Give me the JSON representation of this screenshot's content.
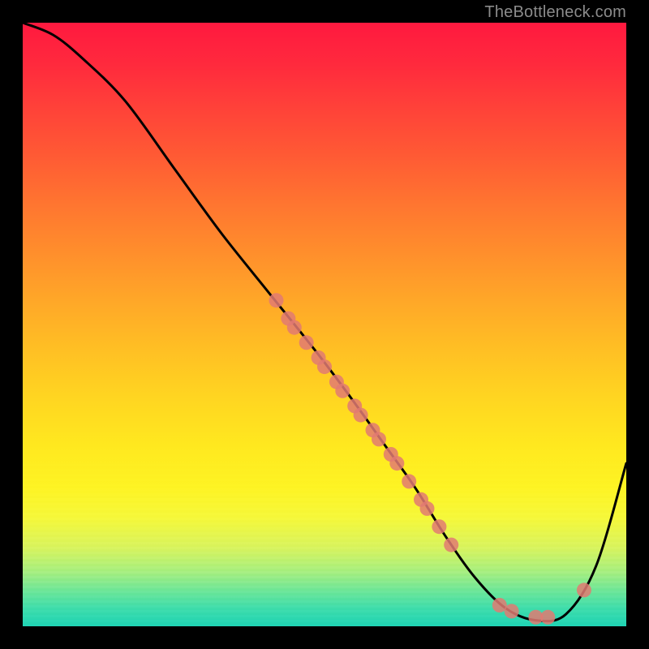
{
  "watermark": {
    "text": "TheBottleneck.com"
  },
  "chart_data": {
    "type": "line",
    "title": "",
    "xlabel": "",
    "ylabel": "",
    "xlim": [
      0,
      100
    ],
    "ylim": [
      0,
      100
    ],
    "grid_on": false,
    "legend": {
      "visible": false
    },
    "series": [
      {
        "name": "bottleneck-curve",
        "color": "#000000",
        "x": [
          0,
          5,
          10,
          17,
          25,
          33,
          41,
          49,
          55,
          60,
          65,
          70,
          75,
          80,
          85,
          90,
          95,
          100
        ],
        "values": [
          100,
          98,
          94,
          87,
          76,
          65,
          55,
          45,
          37,
          30,
          23,
          15,
          8,
          3,
          1,
          2,
          10,
          27
        ]
      }
    ],
    "markers": {
      "name": "highlighted-points",
      "color": "#e27a72",
      "radius": 9,
      "points": [
        {
          "x": 42,
          "y": 54
        },
        {
          "x": 44,
          "y": 51
        },
        {
          "x": 45,
          "y": 49.5
        },
        {
          "x": 47,
          "y": 47
        },
        {
          "x": 49,
          "y": 44.5
        },
        {
          "x": 50,
          "y": 43
        },
        {
          "x": 52,
          "y": 40.5
        },
        {
          "x": 53,
          "y": 39
        },
        {
          "x": 55,
          "y": 36.5
        },
        {
          "x": 56,
          "y": 35
        },
        {
          "x": 58,
          "y": 32.5
        },
        {
          "x": 59,
          "y": 31
        },
        {
          "x": 61,
          "y": 28.5
        },
        {
          "x": 62,
          "y": 27
        },
        {
          "x": 64,
          "y": 24
        },
        {
          "x": 66,
          "y": 21
        },
        {
          "x": 67,
          "y": 19.5
        },
        {
          "x": 69,
          "y": 16.5
        },
        {
          "x": 71,
          "y": 13.5
        },
        {
          "x": 79,
          "y": 3.5
        },
        {
          "x": 81,
          "y": 2.5
        },
        {
          "x": 85,
          "y": 1.5
        },
        {
          "x": 87,
          "y": 1.5
        },
        {
          "x": 93,
          "y": 6
        }
      ]
    }
  }
}
